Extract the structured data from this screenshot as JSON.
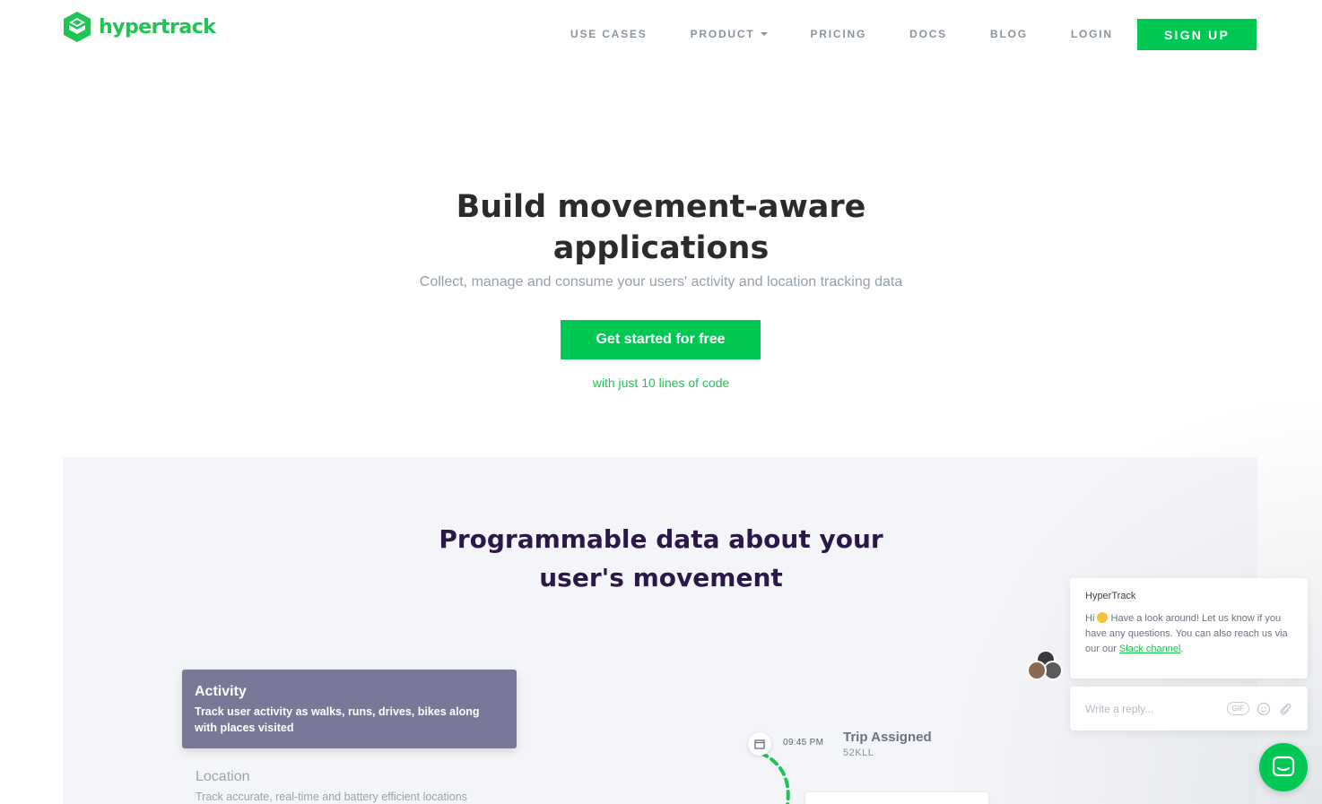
{
  "header": {
    "logo_text": "hypertrack",
    "nav": [
      {
        "label": "USE CASES"
      },
      {
        "label": "PRODUCT"
      },
      {
        "label": "PRICING"
      },
      {
        "label": "DOCS"
      },
      {
        "label": "BLOG"
      },
      {
        "label": "LOGIN"
      }
    ],
    "signup_label": "SIGN UP"
  },
  "hero": {
    "title_line1": "Build movement-aware",
    "title_line2": "applications",
    "subtitle": "Collect, manage and consume your users' activity and location tracking data",
    "cta_label": "Get started for free",
    "cta_note": "with just 10 lines of code"
  },
  "section": {
    "title_line1": "Programmable data about your",
    "title_line2": "user's movement",
    "features": [
      {
        "title": "Activity",
        "desc_line1": "Track user activity as walks, runs, drives, bikes along",
        "desc_line2": "with places visited"
      },
      {
        "title": "Location",
        "desc": "Track accurate, real-time and battery efficient locations"
      }
    ],
    "timeline": {
      "time": "09:45 PM",
      "title": "Trip Assigned",
      "sub": "52KLL"
    }
  },
  "chat": {
    "name": "HyperTrack",
    "msg_before_emoji": "Hi ",
    "msg_after_emoji": " Have a look around! Let us know if you have any questions. You can also reach us via our our ",
    "link_text": "Slack channel",
    "msg_end": ".",
    "reply_placeholder": "Write a reply...",
    "gif_label": "GIF"
  },
  "colors": {
    "brand_green": "#00c853",
    "activity_card": "#7a7899",
    "title_dark": "#2a1848"
  }
}
